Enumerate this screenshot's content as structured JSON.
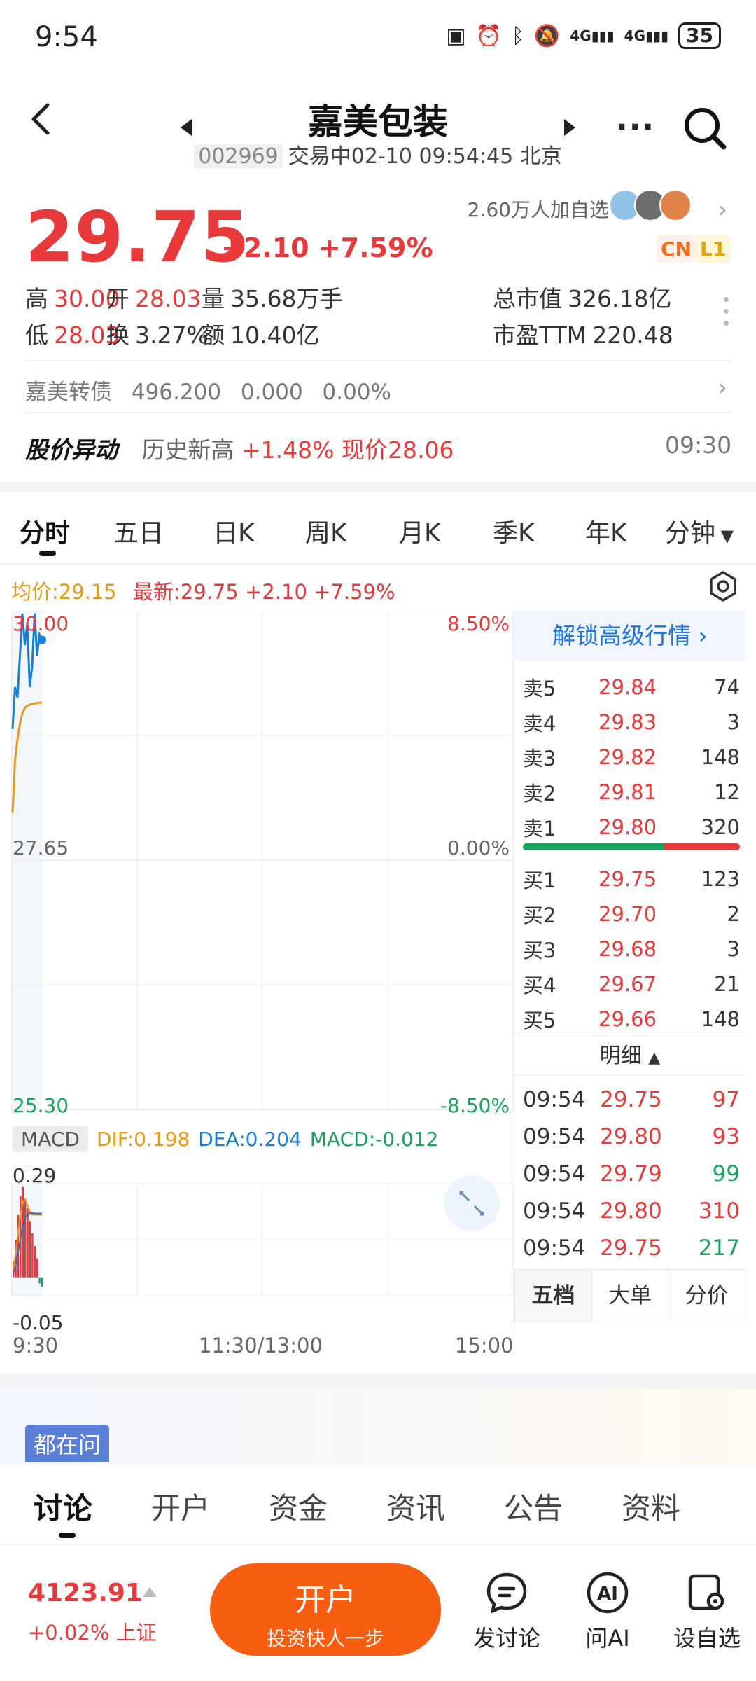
{
  "status_bar": {
    "time": "9:54",
    "signal1": "4G",
    "signal2": "4G",
    "battery": "35"
  },
  "nav": {
    "title": "嘉美包装",
    "code": "002969",
    "status": "交易中02-10 09:54:45 北京"
  },
  "quote": {
    "price": "29.75",
    "change": "+2.10",
    "change_pct": "+7.59%",
    "watchers": "2.60万人加自选",
    "badge_cn": "CN",
    "badge_l1": "L1",
    "stats": {
      "high_label": "高",
      "high": "30.00",
      "open_label": "开",
      "open": "28.03",
      "vol_label": "量",
      "vol": "35.68万手",
      "mcap_label": "总市值",
      "mcap": "326.18亿",
      "low_label": "低",
      "low": "28.03",
      "turn_label": "换",
      "turn": "3.27%",
      "amt_label": "额",
      "amt": "10.40亿",
      "pe_label": "市盈TTM",
      "pe": "220.48"
    },
    "bond": {
      "name": "嘉美转债",
      "price": "496.200",
      "change": "0.000",
      "pct": "0.00%"
    },
    "alert": {
      "title": "股价异动",
      "text": "历史新高",
      "pct": "+1.48%",
      "price": "现价28.06",
      "time": "09:30"
    }
  },
  "tabs": [
    "分时",
    "五日",
    "日K",
    "周K",
    "月K",
    "季K",
    "年K",
    "分钟"
  ],
  "chart_header": {
    "avg": "均价:29.15",
    "latest": "最新:29.75",
    "change": "+2.10",
    "pct": "+7.59%"
  },
  "chart_data": {
    "type": "line",
    "series": [
      {
        "name": "最新",
        "values": [
          28.9,
          29.3,
          29.2,
          29.6,
          30.0,
          29.7,
          29.9,
          29.3,
          29.5,
          30.0,
          29.6,
          29.8,
          29.75
        ]
      },
      {
        "name": "均价",
        "values": [
          28.1,
          28.6,
          28.8,
          28.95,
          29.05,
          29.1,
          29.12,
          29.13,
          29.14,
          29.14,
          29.15,
          29.15,
          29.15
        ]
      }
    ],
    "ylim": [
      25.3,
      30.0
    ],
    "y_labels_left": [
      "30.00",
      "27.65",
      "25.30"
    ],
    "y_labels_right": [
      "8.50%",
      "0.00%",
      "-8.50%"
    ],
    "x_labels": [
      "9:30",
      "11:30/13:00",
      "15:00"
    ],
    "macd": {
      "label": "MACD",
      "dif": "DIF:0.198",
      "dea": "DEA:0.204",
      "macd": "MACD:-0.012",
      "ymax": "0.29",
      "ymin": "-0.05",
      "bars": [
        0.05,
        0.12,
        0.2,
        0.26,
        0.29,
        0.25,
        0.22,
        0.18,
        0.14,
        0.1,
        0.06,
        -0.02,
        -0.03
      ],
      "dif_line": [
        0.02,
        0.08,
        0.14,
        0.2,
        0.24,
        0.25,
        0.23,
        0.21,
        0.2,
        0.2,
        0.2,
        0.2,
        0.198
      ],
      "dea_line": [
        0.01,
        0.04,
        0.08,
        0.12,
        0.16,
        0.19,
        0.2,
        0.205,
        0.205,
        0.204,
        0.204,
        0.204,
        0.204
      ]
    }
  },
  "order_book": {
    "unlock": "解锁高级行情",
    "asks": [
      {
        "label": "卖5",
        "price": "29.84",
        "qty": "74"
      },
      {
        "label": "卖4",
        "price": "29.83",
        "qty": "3"
      },
      {
        "label": "卖3",
        "price": "29.82",
        "qty": "148"
      },
      {
        "label": "卖2",
        "price": "29.81",
        "qty": "12"
      },
      {
        "label": "卖1",
        "price": "29.80",
        "qty": "320"
      }
    ],
    "bids": [
      {
        "label": "买1",
        "price": "29.75",
        "qty": "123"
      },
      {
        "label": "买2",
        "price": "29.70",
        "qty": "2"
      },
      {
        "label": "买3",
        "price": "29.68",
        "qty": "3"
      },
      {
        "label": "买4",
        "price": "29.67",
        "qty": "21"
      },
      {
        "label": "买5",
        "price": "29.66",
        "qty": "148"
      }
    ],
    "detail_label": "明细",
    "trades": [
      {
        "time": "09:54",
        "price": "29.75",
        "qty": "97",
        "dir": "up"
      },
      {
        "time": "09:54",
        "price": "29.80",
        "qty": "93",
        "dir": "up"
      },
      {
        "time": "09:54",
        "price": "29.79",
        "qty": "99",
        "dir": "down"
      },
      {
        "time": "09:54",
        "price": "29.80",
        "qty": "310",
        "dir": "up"
      },
      {
        "time": "09:54",
        "price": "29.75",
        "qty": "217",
        "dir": "down"
      }
    ],
    "tabs": [
      "五档",
      "大单",
      "分价"
    ]
  },
  "ask_chip": "都在问",
  "bottom_tabs": [
    "讨论",
    "开户",
    "资金",
    "资讯",
    "公告",
    "资料"
  ],
  "footer": {
    "index_value": "4123.91",
    "index_change": "+0.02% 上证",
    "open_btn_l1": "开户",
    "open_btn_l2": "投资快人一步",
    "discuss": "发讨论",
    "ai": "问AI",
    "add_watch": "设自选"
  },
  "colors": {
    "up": "#e8393a",
    "down": "#1aa260",
    "accent": "#f85e12",
    "link": "#1a73e8",
    "avg_line": "#e89a1a",
    "price_line": "#1a7fd4"
  }
}
